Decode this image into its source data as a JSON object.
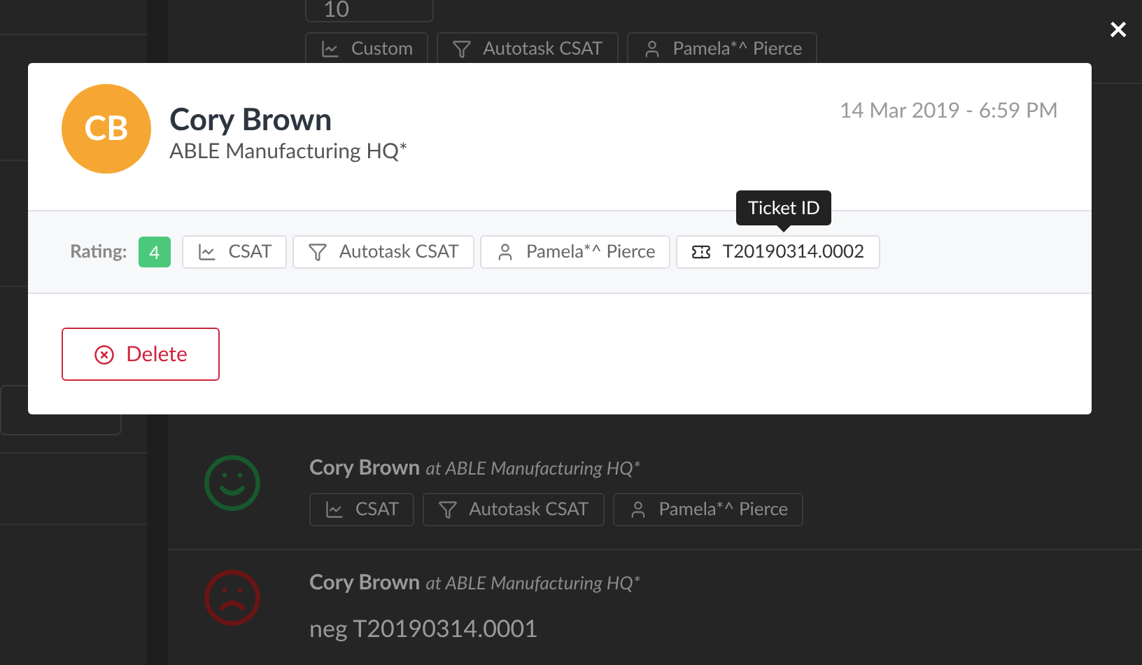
{
  "background": {
    "top_value": "10",
    "top_tags": [
      {
        "kind": "chart",
        "label": "Custom"
      },
      {
        "kind": "filter",
        "label": "Autotask CSAT"
      },
      {
        "kind": "user",
        "label": "Pamela*^ Pierce"
      }
    ],
    "feed": [
      {
        "kind": "positive",
        "name": "Cory Brown",
        "company": "at ABLE Manufacturing HQ*",
        "tags": [
          {
            "kind": "chart",
            "label": "CSAT"
          },
          {
            "kind": "filter",
            "label": "Autotask CSAT"
          },
          {
            "kind": "user",
            "label": "Pamela*^ Pierce"
          }
        ]
      },
      {
        "kind": "negative",
        "name": "Cory Brown",
        "company": "at ABLE Manufacturing HQ*",
        "comment": "neg T20190314.0001"
      }
    ]
  },
  "close": "×",
  "modal": {
    "initials": "CB",
    "name": "Cory Brown",
    "company": "ABLE Manufacturing HQ*",
    "date": "14 Mar 2019 - 6:59 PM",
    "rating_label": "Rating:",
    "rating": "4",
    "tags": [
      {
        "kind": "chart",
        "label": "CSAT"
      },
      {
        "kind": "filter",
        "label": "Autotask CSAT"
      },
      {
        "kind": "user",
        "label": "Pamela*^ Pierce"
      },
      {
        "kind": "ticket",
        "label": "T20190314.0002",
        "tooltip": "Ticket ID"
      }
    ],
    "delete": "Delete"
  }
}
